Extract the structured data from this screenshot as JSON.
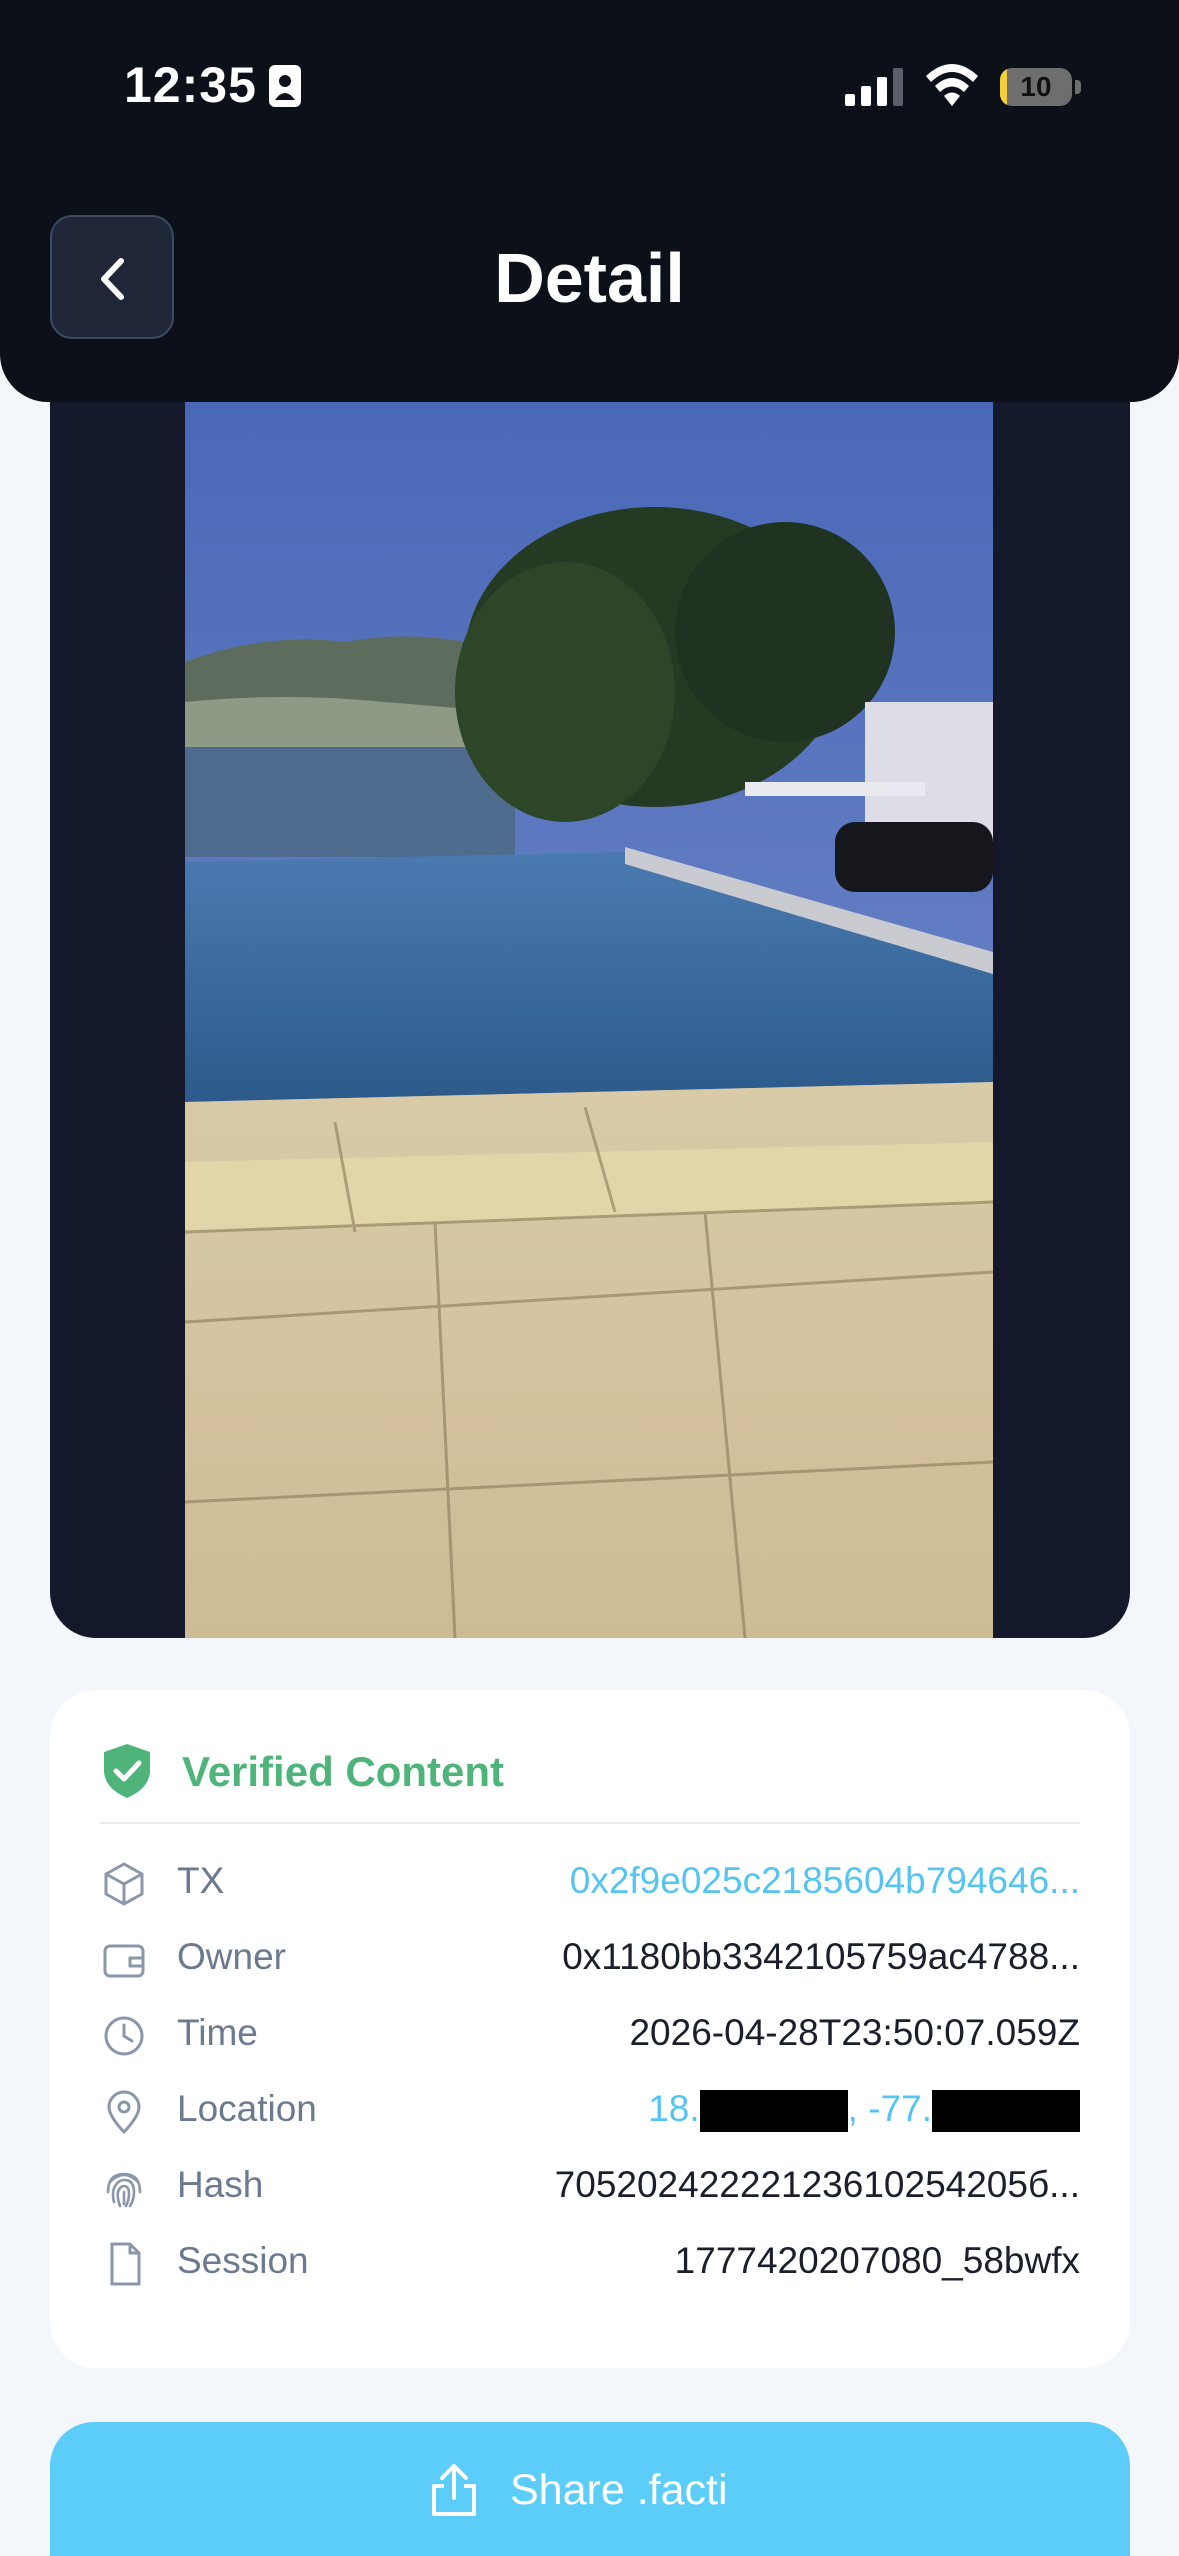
{
  "status_bar": {
    "time": "12:35",
    "battery_level": "10",
    "battery_fraction": 0.1,
    "icons": [
      "id-card-icon",
      "cellular-signal-icon",
      "wifi-icon",
      "battery-icon"
    ]
  },
  "header": {
    "title": "Detail",
    "back_icon": "chevron-left-icon"
  },
  "verification": {
    "title": "Verified Content",
    "icon": "shield-check-icon",
    "accent_color": "#4fb479",
    "rows": [
      {
        "label": "TX",
        "value": "0x2f9e025c2185604b794646...",
        "icon": "cube-icon"
      },
      {
        "label": "Owner",
        "value": "0x1180bb3342105759ac4788...",
        "icon": "wallet-icon"
      },
      {
        "label": "Time",
        "value": "2026-04-28T23:50:07.059Z",
        "icon": "clock-icon"
      },
      {
        "label": "Location",
        "value_lat": "18.",
        "value_sep": ", -77.",
        "icon": "map-pin-icon"
      },
      {
        "label": "Hash",
        "value": "70520242222123610254205б...",
        "icon": "fingerprint-icon"
      },
      {
        "label": "Session",
        "value": "1777420207080_58bwfx",
        "icon": "file-icon"
      }
    ]
  },
  "share": {
    "label": "Share .facti",
    "icon": "share-icon",
    "color": "#5cccf8"
  }
}
